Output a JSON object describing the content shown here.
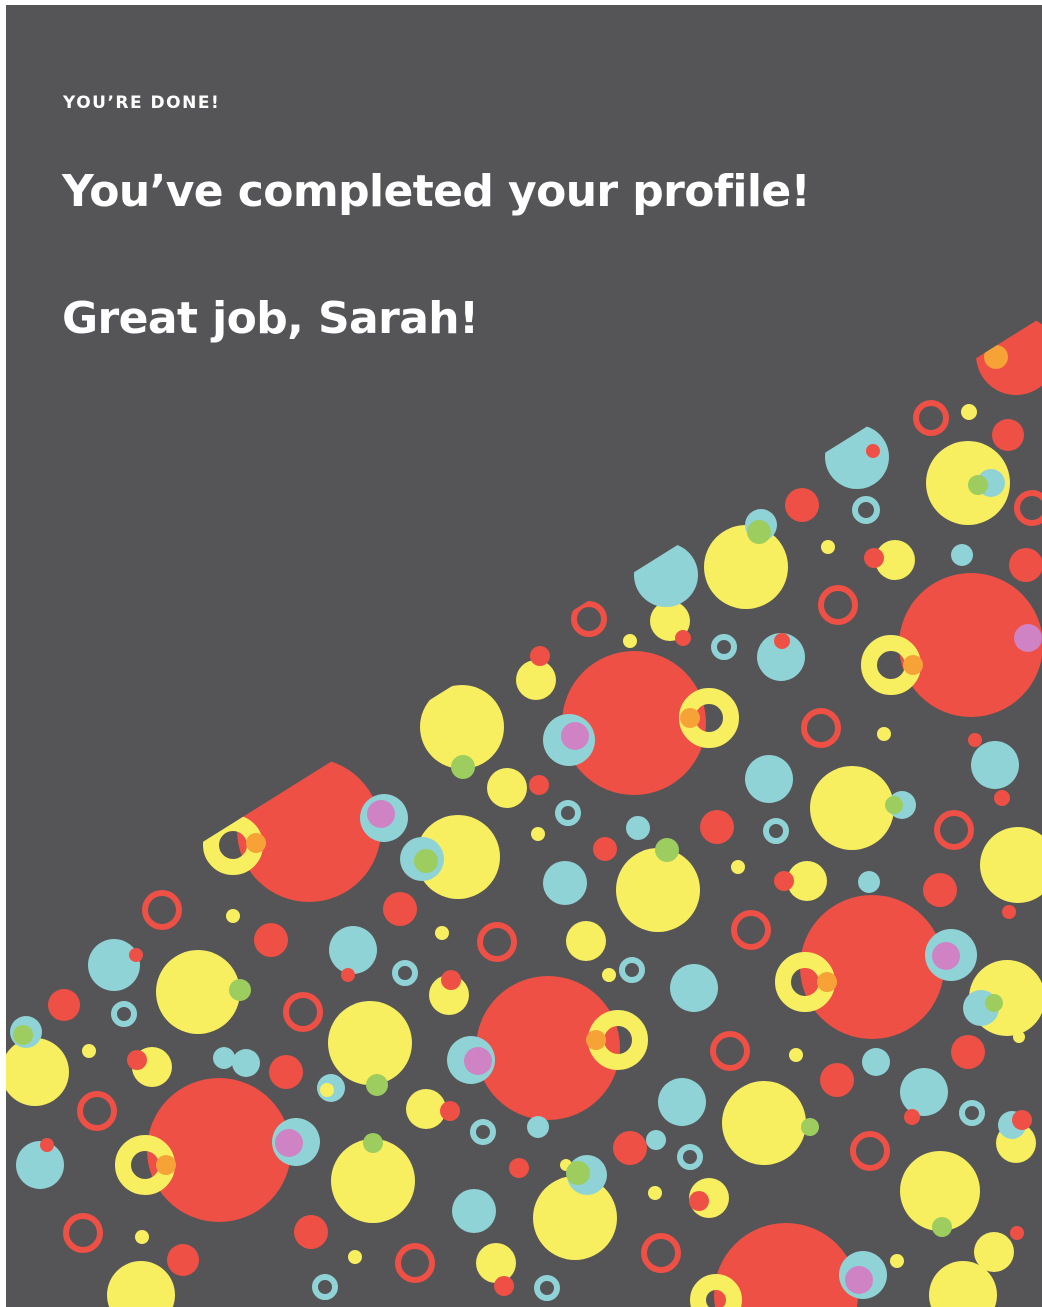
{
  "header": {
    "eyebrow": "YOU’RE DONE!",
    "title": "You’ve completed your profile!",
    "subtitle": "Great job, Sarah!"
  },
  "colors": {
    "background": "#555457",
    "text": "#ffffff",
    "confetti_red": "#ef5045",
    "confetti_yellow": "#f8ef60",
    "confetti_cyan": "#8fd3d6",
    "confetti_orange": "#f7a237",
    "confetti_green": "#9ccd5e",
    "confetti_pink": "#cf82c4"
  }
}
